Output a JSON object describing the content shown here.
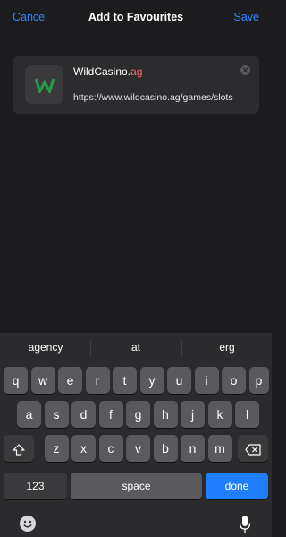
{
  "navbar": {
    "cancel_label": "Cancel",
    "title": "Add to Favourites",
    "save_label": "Save"
  },
  "favourite": {
    "name_prefix": "WildCasino.",
    "name_selected": "ag",
    "url": "https://www.wildcasino.ag/games/slots",
    "icon_letter": "W"
  },
  "keyboard": {
    "suggestions": [
      "agency",
      "at",
      "erg"
    ],
    "row1": [
      "q",
      "w",
      "e",
      "r",
      "t",
      "y",
      "u",
      "i",
      "o",
      "p"
    ],
    "row2": [
      "a",
      "s",
      "d",
      "f",
      "g",
      "h",
      "j",
      "k",
      "l"
    ],
    "row3": [
      "z",
      "x",
      "c",
      "v",
      "b",
      "n",
      "m"
    ],
    "numbers_label": "123",
    "space_label": "space",
    "done_label": "done"
  },
  "colors": {
    "accent": "#2f87ff",
    "done": "#1f7ffe",
    "logo_green": "#2a9a4a"
  }
}
